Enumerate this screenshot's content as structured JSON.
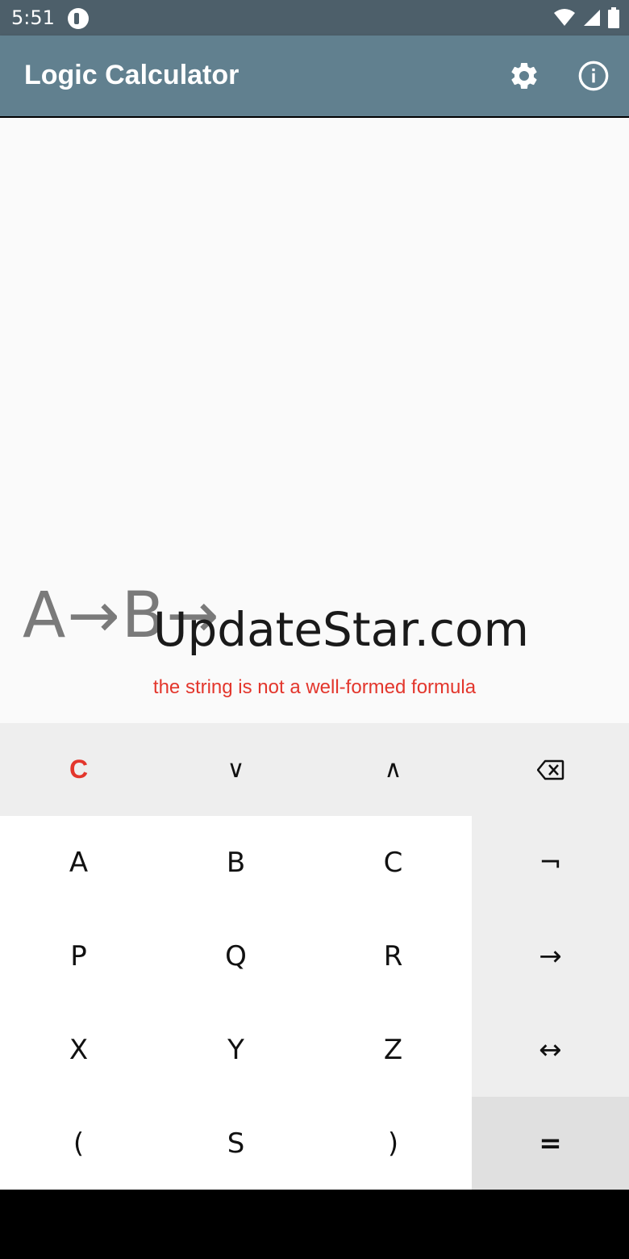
{
  "status_bar": {
    "time": "5:51",
    "icons": [
      "app-notification-icon",
      "wifi-icon",
      "signal-icon",
      "battery-icon"
    ]
  },
  "app_bar": {
    "title": "Logic Calculator",
    "actions": [
      "settings-icon",
      "info-icon"
    ]
  },
  "display": {
    "formula": "A→B→",
    "watermark": "UpdateStar.com",
    "error_message": "the string is not a well-formed formula",
    "error_color": "#e3362c"
  },
  "keypad": {
    "clear": "C",
    "or": "∨",
    "and": "∧",
    "backspace_icon": "backspace-icon",
    "letters": [
      "A",
      "B",
      "C",
      "P",
      "Q",
      "R",
      "X",
      "Y",
      "Z"
    ],
    "open_paren": "(",
    "s_key": "S",
    "close_paren": ")",
    "not": "¬",
    "implies": "→",
    "iff": "↔",
    "equals": "="
  },
  "colors": {
    "app_bar": "#61808f",
    "status_bar": "#4d5f6a",
    "accent_red": "#e3362c"
  }
}
